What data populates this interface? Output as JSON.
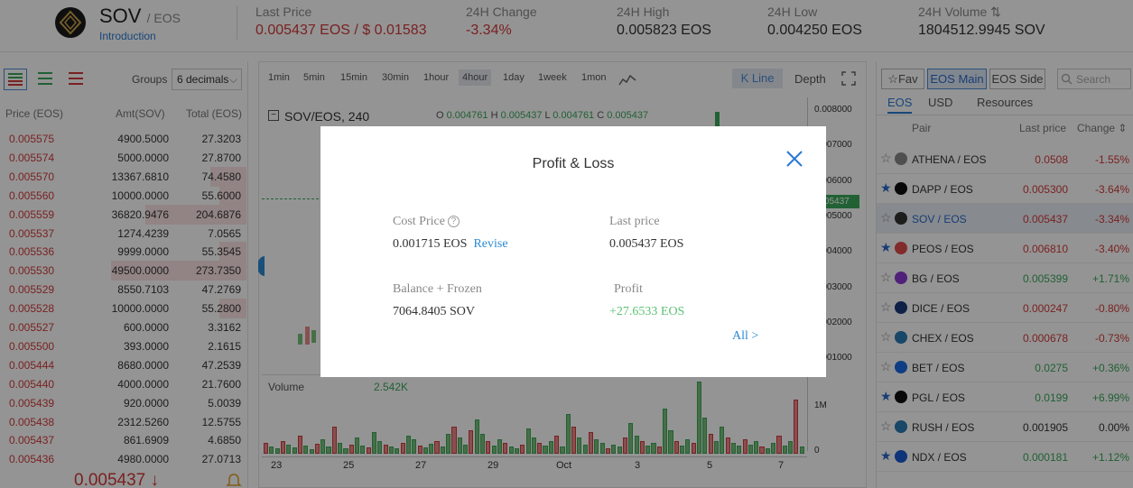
{
  "header": {
    "symbol": "SOV",
    "quote": "/ EOS",
    "intro_link": "Introduction",
    "stats": [
      {
        "label": "Last Price",
        "value": "0.005437 EOS / $ 0.01583"
      },
      {
        "label": "24H Change",
        "value": "-3.34%"
      },
      {
        "label": "24H High",
        "value": "0.005823 EOS"
      },
      {
        "label": "24H Low",
        "value": "0.004250 EOS"
      },
      {
        "label": "24H Volume",
        "value": "1804512.9945 SOV"
      }
    ],
    "last_price_eos": "0.005437 EOS",
    "last_price_sep": "/",
    "last_price_usd": "$ 0.01583"
  },
  "orderbook": {
    "groups_label": "Groups",
    "groups_value": "6 decimals",
    "columns": [
      "Price (EOS)",
      "Amt(SOV)",
      "Total (EOS)"
    ],
    "rows": [
      {
        "price": "0.005575",
        "amt": "4900.5000",
        "total": "27.3203",
        "depth": 0.0
      },
      {
        "price": "0.005574",
        "amt": "5000.0000",
        "total": "27.8700",
        "depth": 0.0
      },
      {
        "price": "0.005570",
        "amt": "13367.6810",
        "total": "74.4580",
        "depth": 0.27
      },
      {
        "price": "0.005560",
        "amt": "10000.0000",
        "total": "55.6000",
        "depth": 0.2
      },
      {
        "price": "0.005559",
        "amt": "36820.9476",
        "total": "204.6876",
        "depth": 0.75
      },
      {
        "price": "0.005537",
        "amt": "1274.4239",
        "total": "7.0565",
        "depth": 0.0
      },
      {
        "price": "0.005536",
        "amt": "9999.0000",
        "total": "55.3545",
        "depth": 0.2
      },
      {
        "price": "0.005530",
        "amt": "49500.0000",
        "total": "273.7350",
        "depth": 1.0
      },
      {
        "price": "0.005529",
        "amt": "8550.7103",
        "total": "47.2769",
        "depth": 0.0
      },
      {
        "price": "0.005528",
        "amt": "10000.0000",
        "total": "55.2800",
        "depth": 0.2
      },
      {
        "price": "0.005527",
        "amt": "600.0000",
        "total": "3.3162",
        "depth": 0.0
      },
      {
        "price": "0.005500",
        "amt": "393.0000",
        "total": "2.1615",
        "depth": 0.0
      },
      {
        "price": "0.005444",
        "amt": "8680.0000",
        "total": "47.2539",
        "depth": 0.0
      },
      {
        "price": "0.005440",
        "amt": "4000.0000",
        "total": "21.7600",
        "depth": 0.0
      },
      {
        "price": "0.005439",
        "amt": "920.0000",
        "total": "5.0039",
        "depth": 0.0
      },
      {
        "price": "0.005438",
        "amt": "2312.5260",
        "total": "12.5755",
        "depth": 0.0
      },
      {
        "price": "0.005437",
        "amt": "861.6909",
        "total": "4.6850",
        "depth": 0.0
      },
      {
        "price": "0.005436",
        "amt": "4980.0000",
        "total": "27.0713",
        "depth": 0.0
      }
    ],
    "last_price_big": "0.005437 ↓"
  },
  "chart": {
    "timeframes": [
      "1min",
      "5min",
      "15min",
      "30min",
      "1hour",
      "4hour",
      "1day",
      "1week",
      "1mon"
    ],
    "selected_timeframe": "4hour",
    "kline_label": "K Line",
    "depth_label": "Depth",
    "title": "SOV/EOS, 240",
    "ohlc": {
      "o": "0.004761",
      "h": "0.005437",
      "l": "0.004761",
      "c": "0.005437"
    },
    "price_ticks": [
      "0.008000",
      "0.007000",
      "0.006000",
      "0.005000",
      "0.004000",
      "0.003000",
      "0.002000",
      "0.001000"
    ],
    "current_tag": "0.005437",
    "volume_label": "Volume",
    "volume_value": "2.542K",
    "volume_ticks": [
      "1M",
      "0"
    ],
    "x_labels": [
      "23",
      "25",
      "27",
      "29",
      "Oct",
      "3",
      "5",
      "7"
    ]
  },
  "right_panel": {
    "tabs": [
      "Fav",
      "EOS Main",
      "EOS Side"
    ],
    "selected_tab": "EOS Main",
    "search_placeholder": "Search",
    "currency_tabs": [
      "EOS",
      "USD",
      "Resources"
    ],
    "selected_currency": "EOS",
    "columns": [
      "Pair",
      "Last price",
      "Change"
    ],
    "pairs": [
      {
        "name": "ATHENA / EOS",
        "price": "0.0508",
        "change": "-1.55%",
        "fav": false,
        "up": false,
        "color": "#888888"
      },
      {
        "name": "DAPP / EOS",
        "price": "0.005300",
        "change": "-3.64%",
        "fav": true,
        "up": false,
        "color": "#111111"
      },
      {
        "name": "SOV / EOS",
        "price": "0.005437",
        "change": "-3.34%",
        "fav": false,
        "up": false,
        "color": "#333333",
        "selected": true
      },
      {
        "name": "PEOS / EOS",
        "price": "0.006810",
        "change": "-3.40%",
        "fav": true,
        "up": false,
        "color": "#e04a4a"
      },
      {
        "name": "BG / EOS",
        "price": "0.005399",
        "change": "+1.71%",
        "fav": false,
        "up": true,
        "color": "#8a3ad2"
      },
      {
        "name": "DICE / EOS",
        "price": "0.000247",
        "change": "-0.80%",
        "fav": false,
        "up": false,
        "color": "#1a3a7a"
      },
      {
        "name": "CHEX / EOS",
        "price": "0.000678",
        "change": "-0.73%",
        "fav": false,
        "up": false,
        "color": "#2a7ab2"
      },
      {
        "name": "BET / EOS",
        "price": "0.0275",
        "change": "+0.36%",
        "fav": false,
        "up": true,
        "color": "#1a6ae2"
      },
      {
        "name": "PGL / EOS",
        "price": "0.0199",
        "change": "+6.99%",
        "fav": true,
        "up": true,
        "color": "#111111"
      },
      {
        "name": "RUSH / EOS",
        "price": "0.001905",
        "change": "0.00%",
        "fav": false,
        "up": null,
        "color": "#2a7ab2"
      },
      {
        "name": "NDX / EOS",
        "price": "0.000181",
        "change": "+1.12%",
        "fav": true,
        "up": true,
        "color": "#1a5ad2"
      }
    ]
  },
  "modal": {
    "title": "Profit & Loss",
    "cost_price_label": "Cost Price",
    "cost_price_value": "0.001715 EOS",
    "revise_link": "Revise",
    "last_price_label": "Last price",
    "last_price_value": "0.005437 EOS",
    "balance_label": "Balance + Frozen",
    "balance_value": "7064.8405 SOV",
    "profit_label": "Profit",
    "profit_value": "+27.6533 EOS",
    "all_link": "All >"
  },
  "colors": {
    "up": "#3aa85a",
    "down": "#d23a3a",
    "accent": "#2a7ad2"
  }
}
